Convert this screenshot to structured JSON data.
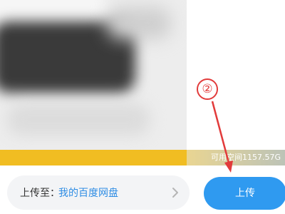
{
  "colors": {
    "storage_bar": "#f4c432",
    "accent_blue": "#2f9af0",
    "link_blue": "#2f8de4",
    "annotation_red": "#e23b3b"
  },
  "storage": {
    "text": "可用空间1157.57G"
  },
  "annotation": {
    "step_number": "②"
  },
  "destination": {
    "label": "上传至：",
    "value": "我的百度网盘",
    "chevron_icon": "chevron-right-icon"
  },
  "upload_button": {
    "label": "上传"
  }
}
